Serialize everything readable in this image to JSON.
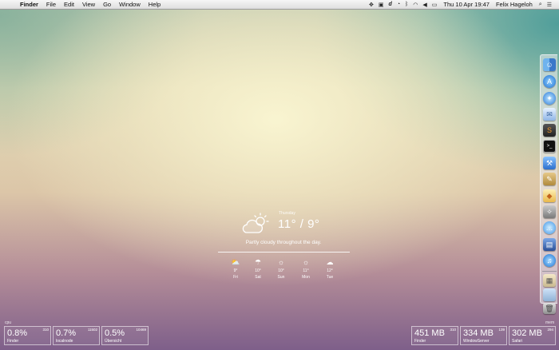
{
  "menubar": {
    "app_name": "Finder",
    "menus": [
      "File",
      "Edit",
      "View",
      "Go",
      "Window",
      "Help"
    ],
    "clock": "Thu 10 Apr  19:47",
    "user": "Felix Hageloh",
    "status_icons": [
      "dropbox-icon",
      "app-icon",
      "d-icon",
      "time-machine-icon",
      "bluetooth-icon",
      "wifi-icon",
      "volume-icon",
      "battery-icon",
      "spotlight-icon",
      "list-icon"
    ]
  },
  "dock": {
    "apps": [
      "Finder",
      "App Store",
      "Safari",
      "Mail",
      "Sublime",
      "Terminal",
      "Xcode",
      "Script Editor",
      "Sketch",
      "Secrets",
      "Messages",
      "VirtualBox",
      "iTunes"
    ],
    "stack_icons": [
      "downloads-icon",
      "folder-icon",
      "trash-icon"
    ]
  },
  "weather": {
    "day": "Thursday",
    "temp": "11° / 9°",
    "summary": "Partly cloudy throughout the day.",
    "forecast": [
      {
        "day": "Fri",
        "temp": "9°",
        "icon": "sun-cloud-icon"
      },
      {
        "day": "Sat",
        "temp": "10°",
        "icon": "rain-icon"
      },
      {
        "day": "Sun",
        "temp": "10°",
        "icon": "sun-icon"
      },
      {
        "day": "Mon",
        "temp": "11°",
        "icon": "sun-icon"
      },
      {
        "day": "Tue",
        "temp": "12°",
        "icon": "cloud-icon"
      }
    ]
  },
  "cpu": {
    "label": "cpu",
    "processes": [
      {
        "value": "0.8%",
        "pid": "310",
        "name": "Finder"
      },
      {
        "value": "0.7%",
        "pid": "11502",
        "name": "localnode"
      },
      {
        "value": "0.5%",
        "pid": "10469",
        "name": "Übersicht"
      }
    ]
  },
  "mem": {
    "label": "mem",
    "processes": [
      {
        "value": "451 MB",
        "pid": "310",
        "name": "Finder"
      },
      {
        "value": "334 MB",
        "pid": "139",
        "name": "WindowServer"
      },
      {
        "value": "302 MB",
        "pid": "294",
        "name": "Safari"
      }
    ]
  }
}
